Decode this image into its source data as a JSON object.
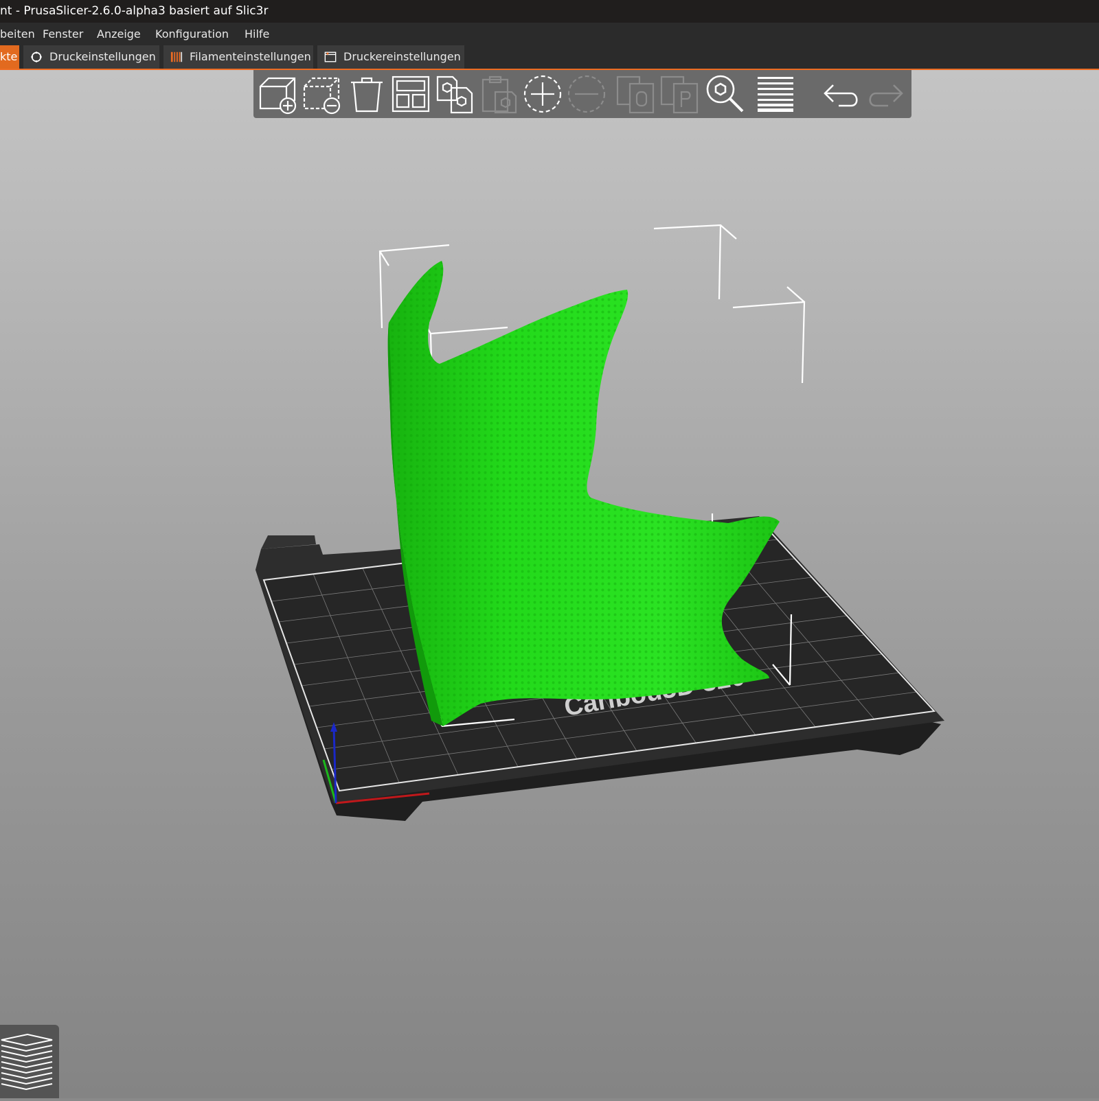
{
  "window": {
    "title": "nt - PrusaSlicer-2.6.0-alpha3 basiert auf Slic3r"
  },
  "menu": {
    "items": [
      "beiten",
      "Fenster",
      "Anzeige",
      "Konfiguration",
      "Hilfe"
    ]
  },
  "tabs": [
    {
      "label": "kte",
      "active": true
    },
    {
      "label": "Druckeinstellungen",
      "icon": "cog-icon"
    },
    {
      "label": "Filamenteinstellungen",
      "icon": "filament-spool-icon"
    },
    {
      "label": "Druckereinstellungen",
      "icon": "printer-icon"
    }
  ],
  "toolbar": {
    "tools": [
      {
        "name": "add-object",
        "icon": "add-cube-icon",
        "enabled": true
      },
      {
        "name": "delete-object",
        "icon": "remove-cube-icon",
        "enabled": true
      },
      {
        "name": "delete-all",
        "icon": "trash-icon",
        "enabled": true
      },
      {
        "name": "arrange",
        "icon": "arrange-icon",
        "enabled": true
      },
      {
        "name": "copy",
        "icon": "copy-icon",
        "enabled": true
      },
      {
        "name": "paste",
        "icon": "paste-icon",
        "enabled": false
      },
      {
        "name": "add-instance",
        "icon": "add-instance-icon",
        "enabled": true
      },
      {
        "name": "remove-instance",
        "icon": "remove-instance-icon",
        "enabled": false
      },
      {
        "name": "split-objects",
        "icon": "split-objects-icon",
        "enabled": false
      },
      {
        "name": "split-parts",
        "icon": "split-parts-icon",
        "enabled": false
      },
      {
        "name": "search",
        "icon": "search-icon",
        "enabled": true
      },
      {
        "name": "layer-editing",
        "icon": "layers-icon",
        "enabled": true
      },
      {
        "name": "undo",
        "icon": "undo-icon",
        "enabled": true
      },
      {
        "name": "redo",
        "icon": "redo-icon",
        "enabled": false
      }
    ]
  },
  "bed": {
    "label": "Caribou3D 320"
  },
  "colors": {
    "accent": "#ee6c22",
    "model": "#22d91a",
    "bed": "#2d2d2d"
  }
}
